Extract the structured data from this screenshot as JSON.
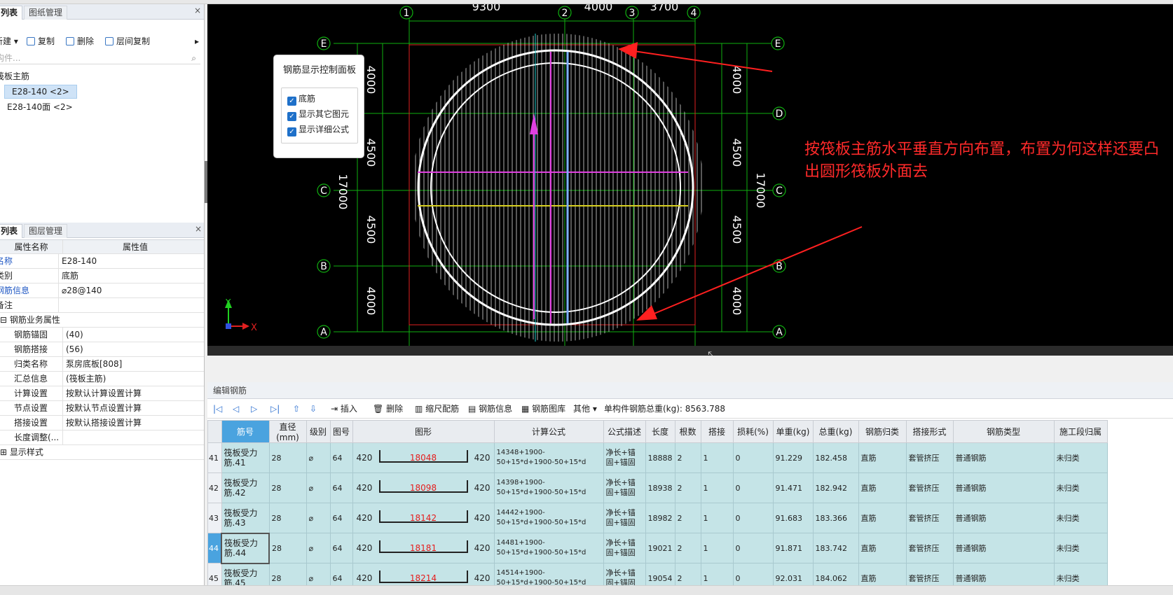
{
  "left_top": {
    "tab_active": "列表",
    "tab_inactive": "图纸管理",
    "close": "×",
    "toolbar": {
      "new": "新建",
      "copy": "复制",
      "delete": "删除",
      "floor_copy": "层间复制",
      "more": "▸"
    },
    "search_placeholder": "构件...",
    "tree_group": "筏板主筋",
    "tree_items": [
      "E28-140 <2>",
      "E28-140面 <2>"
    ]
  },
  "left_bottom": {
    "tab_active": "列表",
    "tab_inactive": "图层管理",
    "close": "×",
    "header": {
      "name": "属性名称",
      "value": "属性值"
    },
    "rows": [
      {
        "n": "名称",
        "v": "E28-140"
      },
      {
        "n": "类别",
        "v": "底筋"
      },
      {
        "n": "钢筋信息",
        "v": "⌀28@140"
      },
      {
        "n": "备注",
        "v": ""
      },
      {
        "n": "钢筋业务属性",
        "v": ""
      },
      {
        "n": "钢筋锚固",
        "v": "(40)"
      },
      {
        "n": "钢筋搭接",
        "v": "(56)"
      },
      {
        "n": "归类名称",
        "v": "泵房底板[808]"
      },
      {
        "n": "汇总信息",
        "v": "(筏板主筋)"
      },
      {
        "n": "计算设置",
        "v": "按默认计算设置计算"
      },
      {
        "n": "节点设置",
        "v": "按默认节点设置计算"
      },
      {
        "n": "搭接设置",
        "v": "按默认搭接设置计算"
      },
      {
        "n": "长度调整(...",
        "v": ""
      },
      {
        "n": "显示样式",
        "v": ""
      }
    ]
  },
  "cad": {
    "axis_numbers_top": [
      "1",
      "2",
      "3",
      "4"
    ],
    "axis_letters_left": [
      "E",
      "D",
      "C",
      "B",
      "A"
    ],
    "top_dims": [
      "9300",
      "4000",
      "3700"
    ],
    "left_dims": [
      "4000",
      "4500",
      "4500",
      "4000"
    ],
    "total_dim": "17000",
    "control_panel": {
      "title": "钢筋显示控制面板",
      "options": [
        "底筋",
        "显示其它图元",
        "显示详细公式"
      ]
    },
    "annotation": "按筏板主筋水平垂直方向布置，布置为何这样还要凸出圆形筏板外面去",
    "axis_x": "X",
    "axis_y": "Y",
    "colors": {
      "grid_green": "#10b010",
      "frame_red": "#e02020",
      "arrow_red": "#ff2020",
      "rebar_white": "#ffffff"
    }
  },
  "editor": {
    "title": "编辑钢筋",
    "toolbar": {
      "insert": "插入",
      "delete": "删除",
      "scale": "缩尺配筋",
      "info": "钢筋信息",
      "library": "钢筋图库",
      "other": "其他",
      "total_label": "单构件钢筋总重(kg): 8563.788"
    },
    "columns": [
      "筋号",
      "直径(mm)",
      "级别",
      "图号",
      "图形",
      "计算公式",
      "公式描述",
      "长度",
      "根数",
      "搭接",
      "损耗(%)",
      "单重(kg)",
      "总重(kg)",
      "钢筋归类",
      "搭接形式",
      "钢筋类型",
      "施工段归属"
    ],
    "rows": [
      {
        "rn": "41",
        "name": "筏板受力筋.41",
        "dia": "28",
        "grade": "⌀",
        "fig": "64",
        "left": "420",
        "len": "18048",
        "right": "420",
        "formula": "14348+1900-50+15*d+1900-50+15*d",
        "desc": "净长+锚固+锚固",
        "length": "18888",
        "count": "2",
        "lap": "1",
        "loss": "0",
        "unit": "91.229",
        "total": "182.458",
        "cat": "直筋",
        "lapform": "套管挤压",
        "type": "普通钢筋",
        "stage": "未归类"
      },
      {
        "rn": "42",
        "name": "筏板受力筋.42",
        "dia": "28",
        "grade": "⌀",
        "fig": "64",
        "left": "420",
        "len": "18098",
        "right": "420",
        "formula": "14398+1900-50+15*d+1900-50+15*d",
        "desc": "净长+锚固+锚固",
        "length": "18938",
        "count": "2",
        "lap": "1",
        "loss": "0",
        "unit": "91.471",
        "total": "182.942",
        "cat": "直筋",
        "lapform": "套管挤压",
        "type": "普通钢筋",
        "stage": "未归类"
      },
      {
        "rn": "43",
        "name": "筏板受力筋.43",
        "dia": "28",
        "grade": "⌀",
        "fig": "64",
        "left": "420",
        "len": "18142",
        "right": "420",
        "formula": "14442+1900-50+15*d+1900-50+15*d",
        "desc": "净长+锚固+锚固",
        "length": "18982",
        "count": "2",
        "lap": "1",
        "loss": "0",
        "unit": "91.683",
        "total": "183.366",
        "cat": "直筋",
        "lapform": "套管挤压",
        "type": "普通钢筋",
        "stage": "未归类"
      },
      {
        "rn": "44",
        "name": "筏板受力筋.44",
        "dia": "28",
        "grade": "⌀",
        "fig": "64",
        "left": "420",
        "len": "18181",
        "right": "420",
        "formula": "14481+1900-50+15*d+1900-50+15*d",
        "desc": "净长+锚固+锚固",
        "length": "19021",
        "count": "2",
        "lap": "1",
        "loss": "0",
        "unit": "91.871",
        "total": "183.742",
        "cat": "直筋",
        "lapform": "套管挤压",
        "type": "普通钢筋",
        "stage": "未归类"
      },
      {
        "rn": "45",
        "name": "筏板受力筋.45",
        "dia": "28",
        "grade": "⌀",
        "fig": "64",
        "left": "420",
        "len": "18214",
        "right": "420",
        "formula": "14514+1900-50+15*d+1900-50+15*d",
        "desc": "净长+锚固+锚固",
        "length": "19054",
        "count": "2",
        "lap": "1",
        "loss": "0",
        "unit": "92.031",
        "total": "184.062",
        "cat": "直筋",
        "lapform": "套管挤压",
        "type": "普通钢筋",
        "stage": "未归类"
      }
    ]
  }
}
